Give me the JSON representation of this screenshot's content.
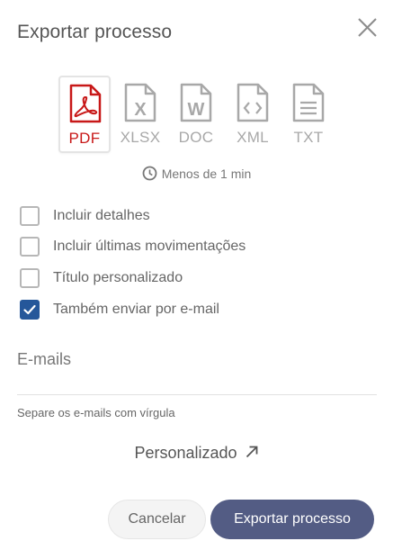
{
  "dialog": {
    "title": "Exportar processo"
  },
  "formats": [
    {
      "label": "PDF",
      "icon": "pdf-file-icon",
      "selected": true,
      "color": "#c81818"
    },
    {
      "label": "XLSX",
      "icon": "xlsx-file-icon",
      "selected": false,
      "color": "#a8a8a8"
    },
    {
      "label": "DOC",
      "icon": "doc-file-icon",
      "selected": false,
      "color": "#a8a8a8"
    },
    {
      "label": "XML",
      "icon": "xml-file-icon",
      "selected": false,
      "color": "#a8a8a8"
    },
    {
      "label": "TXT",
      "icon": "txt-file-icon",
      "selected": false,
      "color": "#a8a8a8"
    }
  ],
  "estimate": {
    "icon": "clock-icon",
    "text": "Menos de 1 min"
  },
  "options": [
    {
      "label": "Incluir detalhes",
      "checked": false
    },
    {
      "label": "Incluir últimas movimentações",
      "checked": false
    },
    {
      "label": "Título personalizado",
      "checked": false
    },
    {
      "label": "Também enviar por e-mail",
      "checked": true
    }
  ],
  "email": {
    "label": "E-mails",
    "value": "",
    "hint": "Separe os e-mails com vírgula"
  },
  "custom_link": {
    "label": "Personalizado",
    "icon": "arrow-up-right-icon"
  },
  "buttons": {
    "cancel": "Cancelar",
    "export": "Exportar processo"
  },
  "colors": {
    "accent": "#535c84",
    "checkbox_checked": "#25579a",
    "pdf_red": "#c81818"
  }
}
